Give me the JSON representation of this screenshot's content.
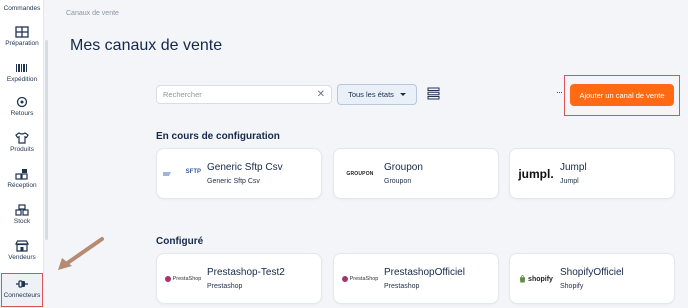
{
  "sidebar": {
    "items": [
      {
        "label": "Commandes",
        "icon": "orders-icon"
      },
      {
        "label": "Préparation",
        "icon": "preparation-icon"
      },
      {
        "label": "Expédition",
        "icon": "barcode-icon"
      },
      {
        "label": "Retours",
        "icon": "returns-icon"
      },
      {
        "label": "Produits",
        "icon": "tshirt-icon"
      },
      {
        "label": "Réception",
        "icon": "reception-icon"
      },
      {
        "label": "Stock",
        "icon": "stock-icon"
      },
      {
        "label": "Vendeurs",
        "icon": "store-icon"
      },
      {
        "label": "Connecteurs",
        "icon": "connector-icon"
      }
    ],
    "active": "Connecteurs"
  },
  "header": {
    "breadcrumb": "Canaux de vente",
    "title": "Mes canaux de vente"
  },
  "toolbar": {
    "search_placeholder": "Rechercher",
    "state_filter": "Tous les états",
    "more": "···",
    "add_label": "Ajouter un canal de vente"
  },
  "sections": {
    "in_progress": {
      "title": "En cours de configuration",
      "cards": [
        {
          "name": "Generic Sftp Csv",
          "sub": "Generic Sftp Csv",
          "logo": "SFTP"
        },
        {
          "name": "Groupon",
          "sub": "Groupon",
          "logo": "GROUPON"
        },
        {
          "name": "Jumpl",
          "sub": "Jumpl",
          "logo": "jumpl."
        }
      ]
    },
    "configured": {
      "title": "Configuré",
      "cards": [
        {
          "name": "Prestashop-Test2",
          "sub": "Prestashop",
          "logo": "PrestaShop"
        },
        {
          "name": "PrestashopOfficiel",
          "sub": "Prestashop",
          "logo": "PrestaShop"
        },
        {
          "name": "ShopifyOfficiel",
          "sub": "Shopify",
          "logo": "shopify"
        }
      ]
    }
  },
  "colors": {
    "accent": "#ff6a13",
    "highlight": "#d9535a",
    "title": "#15294a",
    "background": "#f3f5f8"
  }
}
